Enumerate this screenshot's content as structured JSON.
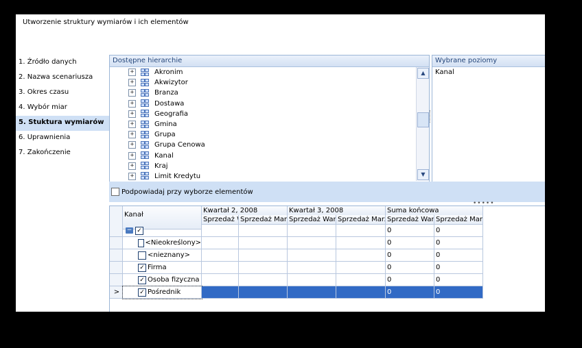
{
  "window": {
    "title": "Utworzenie struktury wymiarów i ich elementów"
  },
  "steps": [
    {
      "label": "1. Źródło danych"
    },
    {
      "label": "2. Nazwa scenariusza"
    },
    {
      "label": "3. Okres czasu"
    },
    {
      "label": "4. Wybór miar"
    },
    {
      "label": "5. Stuktura wymiarów",
      "active": true
    },
    {
      "label": "6. Uprawnienia"
    },
    {
      "label": "7. Zakończenie"
    }
  ],
  "hierarchies": {
    "header": "Dostępne hierarchie",
    "items": [
      "Akronim",
      "Akwizytor",
      "Branza",
      "Dostawa",
      "Geografia",
      "Gmina",
      "Grupa",
      "Grupa Cenowa",
      "Kanal",
      "Kraj",
      "Limit Kredytu"
    ],
    "expander_glyph": "+",
    "icon": "hierarchy-icon"
  },
  "selected_levels": {
    "header": "Wybrane poziomy",
    "items": [
      "Kanal"
    ]
  },
  "option": {
    "label": "Podpowiadaj przy wyborze elementów",
    "checked": false
  },
  "grid": {
    "row_header": "Kanał",
    "groups": [
      "Kwartał 2, 2008",
      "Kwartał 3, 2008",
      "Suma końcowa"
    ],
    "measures": [
      "Sprzedaż Wartość",
      "Sprzedaż Marża"
    ],
    "root": {
      "label": "",
      "checked": true,
      "collapse_glyph": "−"
    },
    "rows": [
      {
        "label": "<Nieokreślony>",
        "checked": false,
        "total_value": "0",
        "total_margin": "0"
      },
      {
        "label": "<nieznany>",
        "checked": false,
        "total_value": "0",
        "total_margin": "0"
      },
      {
        "label": "Firma",
        "checked": true,
        "total_value": "0",
        "total_margin": "0"
      },
      {
        "label": "Osoba fizyczna",
        "checked": true,
        "total_value": "0",
        "total_margin": "0"
      },
      {
        "label": "Pośrednik",
        "checked": true,
        "total_value": "0",
        "total_margin": "0",
        "selected": true
      }
    ],
    "root_totals": {
      "total_value": "0",
      "total_margin": "0"
    },
    "current_row_marker": ">",
    "check_glyph": "✓"
  }
}
